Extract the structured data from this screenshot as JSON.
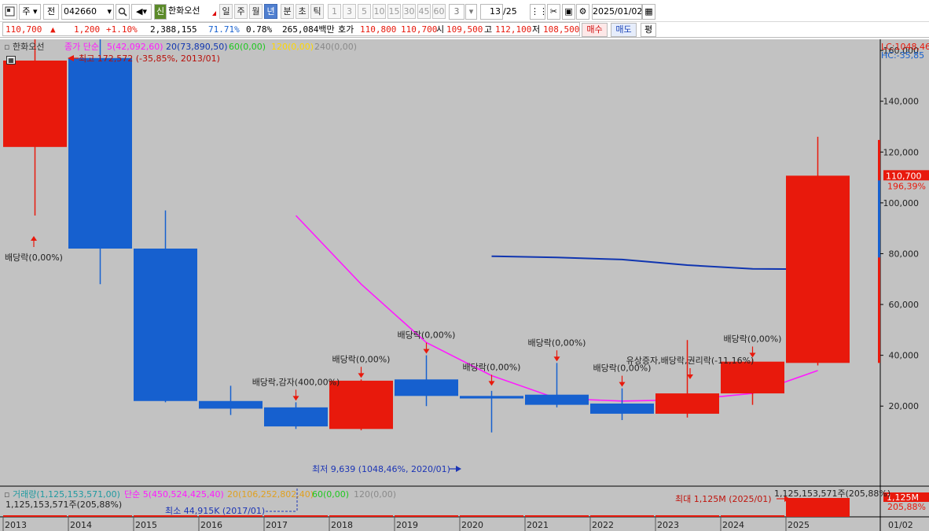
{
  "toolbar": {
    "period_selector": "주",
    "prev_label": "전",
    "code_value": "042660",
    "new_badge": "신",
    "stock_name": "한화오선",
    "period_tabs": [
      "일",
      "주",
      "월",
      "년",
      "분",
      "초",
      "틱"
    ],
    "active_period": "년",
    "num_buttons": [
      "1",
      "3",
      "5",
      "10",
      "15",
      "30",
      "45",
      "60"
    ],
    "count_value": "3",
    "page_counter": "13",
    "page_total": "/25",
    "date_value": "2025/01/02",
    "buy_label": "매수",
    "sell_label": "매도",
    "extra_label": "평"
  },
  "quote": {
    "price": "110,700",
    "up_arrow": "▲",
    "change": "1,200",
    "change_pct": "+1.10%",
    "volume": "2,388,155",
    "ratio": "71.71%",
    "turnover": "0.78%",
    "amount": "265,084백만",
    "bid_label": "호가",
    "bid": "110,800",
    "ask": "110,700",
    "open_label": "시",
    "open": "109,500",
    "high_label": "고",
    "high": "112,100",
    "low_label": "저",
    "low": "108,500"
  },
  "legend": {
    "name": "한화오선",
    "ma_type": "종가 단순",
    "ma5": "5(42,092,60)",
    "ma20": "20(73,890,50)",
    "ma60": "60(0,00)",
    "ma120": "120(0,00)",
    "ma240": "240(0,00)",
    "lc": "LC:1048,46",
    "hc": "HC:-35,85"
  },
  "volume_legend": {
    "label": "거래량(1,125,153,571,00)",
    "ma5": "단순 5(450,524,425,40)",
    "ma20": "20(106,252,802,40)",
    "ma60": "60(0,00)",
    "ma120": "120(0,00)",
    "current": "1,125,153,571주(205,88%)",
    "current_right": "1,125,153,571주(205,88%)",
    "axis_value": "1,125M",
    "axis_pct": "205,88%"
  },
  "colors": {
    "up": "#e8190c",
    "down": "#1660cf",
    "ma5": "#ff1aff",
    "ma20": "#1035b0",
    "ma60": "#1ec81e",
    "ma120": "#ffd700",
    "background": "#c2c2c2"
  },
  "chart_data": {
    "type": "candlestick",
    "interval": "yearly",
    "categories": [
      "2013",
      "2014",
      "2015",
      "2016",
      "2017",
      "2018",
      "2019",
      "2020",
      "2021",
      "2022",
      "2023",
      "2024",
      "2025"
    ],
    "candles": [
      {
        "x": "2013",
        "open": 122000,
        "high": 172572,
        "low": 95000,
        "close": 156000
      },
      {
        "x": "2014",
        "open": 157000,
        "high": 168000,
        "low": 68000,
        "close": 82000
      },
      {
        "x": "2015",
        "open": 82000,
        "high": 97000,
        "low": 21500,
        "close": 22000
      },
      {
        "x": "2016",
        "open": 22000,
        "high": 28000,
        "low": 16500,
        "close": 19000
      },
      {
        "x": "2017",
        "open": 19500,
        "high": 21500,
        "low": 11000,
        "close": 12000
      },
      {
        "x": "2018",
        "open": 11000,
        "high": 30500,
        "low": 10500,
        "close": 30000
      },
      {
        "x": "2019",
        "open": 30500,
        "high": 40000,
        "low": 20000,
        "close": 24000
      },
      {
        "x": "2020",
        "open": 24000,
        "high": 26000,
        "low": 9639,
        "close": 23000
      },
      {
        "x": "2021",
        "open": 24500,
        "high": 37000,
        "low": 19500,
        "close": 20500
      },
      {
        "x": "2022",
        "open": 21000,
        "high": 27000,
        "low": 14500,
        "close": 17000
      },
      {
        "x": "2023",
        "open": 17000,
        "high": 46000,
        "low": 15500,
        "close": 25000
      },
      {
        "x": "2024",
        "open": 25000,
        "high": 38500,
        "low": 20500,
        "close": 37500
      },
      {
        "x": "2025",
        "open": 37000,
        "high": 126000,
        "low": 36000,
        "close": 110700
      }
    ],
    "ma5": [
      null,
      null,
      null,
      null,
      95000,
      68000,
      45000,
      32000,
      23000,
      22000,
      22500,
      25000,
      34000
    ],
    "ma20": [
      null,
      null,
      null,
      null,
      null,
      null,
      null,
      79000,
      78500,
      77700,
      75500,
      74000,
      73890
    ],
    "yaxis_ticks": [
      "160,000",
      "140,000",
      "120,000",
      "100,000",
      "80,000",
      "60,000",
      "40,000",
      "20,000"
    ],
    "ylim": [
      10000,
      172572
    ],
    "current_price": "110,700",
    "current_pct": "196,39%",
    "volume": [
      3,
      3,
      3,
      2,
      2,
      3,
      2,
      3,
      2,
      3,
      4,
      8,
      1125
    ],
    "vol_max": 1125,
    "annotations": [
      {
        "text": "배당락(0,00%)",
        "x": "2013"
      },
      {
        "text": "배당락,감자(400,00%)",
        "x": "2017"
      },
      {
        "text": "배당락(0,00%)",
        "x": "2018"
      },
      {
        "text": "배당락(0,00%)",
        "x": "2019"
      },
      {
        "text": "배당락(0,00%)",
        "x": "2020"
      },
      {
        "text": "배당락(0,00%)",
        "x": "2021"
      },
      {
        "text": "배당락(0,00%)",
        "x": "2022"
      },
      {
        "text": "유상증자,배당락,권리락(-11,16%)",
        "x": "2023"
      },
      {
        "text": "배당락(0,00%)",
        "x": "2024"
      }
    ],
    "high_note": "최고 172,572 (-35,85%, 2013/01)",
    "low_note": "최저 9,639 (1048,46%, 2020/01)",
    "vol_max_note": "최대 1,125M (2025/01)",
    "vol_min_note": "최소 44,915K (2017/01)",
    "x_end_label": "01/02"
  }
}
